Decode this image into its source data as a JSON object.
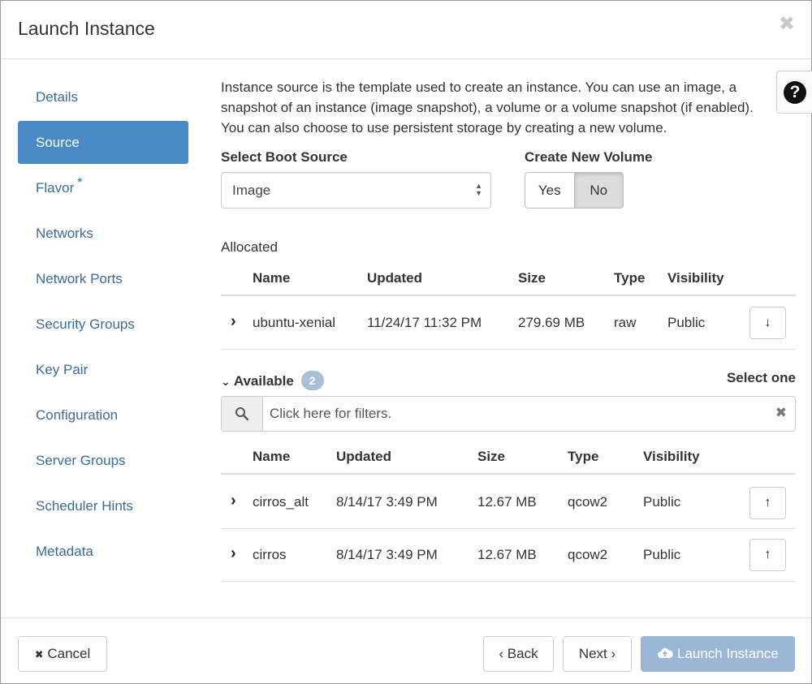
{
  "dialog": {
    "title": "Launch Instance",
    "close_glyph": "✖"
  },
  "sidebar": {
    "items": [
      {
        "label": "Details",
        "active": false
      },
      {
        "label": "Source",
        "active": true
      },
      {
        "label": "Flavor",
        "active": false,
        "required": "*"
      },
      {
        "label": "Networks",
        "active": false
      },
      {
        "label": "Network Ports",
        "active": false
      },
      {
        "label": "Security Groups",
        "active": false
      },
      {
        "label": "Key Pair",
        "active": false
      },
      {
        "label": "Configuration",
        "active": false
      },
      {
        "label": "Server Groups",
        "active": false
      },
      {
        "label": "Scheduler Hints",
        "active": false
      },
      {
        "label": "Metadata",
        "active": false
      }
    ]
  },
  "help": {
    "glyph": "?"
  },
  "main": {
    "description": "Instance source is the template used to create an instance. You can use an image, a snapshot of an instance (image snapshot), a volume or a volume snapshot (if enabled). You can also choose to use persistent storage by creating a new volume.",
    "boot_source": {
      "label": "Select Boot Source",
      "value": "Image"
    },
    "new_volume": {
      "label": "Create New Volume",
      "yes": "Yes",
      "no": "No",
      "selected": "No"
    },
    "allocated": {
      "label": "Allocated",
      "columns": [
        "Name",
        "Updated",
        "Size",
        "Type",
        "Visibility"
      ],
      "rows": [
        {
          "name": "ubuntu-xenial",
          "updated": "11/24/17 11:32 PM",
          "size": "279.69 MB",
          "type": "raw",
          "visibility": "Public"
        }
      ]
    },
    "available": {
      "label": "Available",
      "count": "2",
      "select_hint": "Select one",
      "filter_placeholder": "Click here for filters.",
      "columns": [
        "Name",
        "Updated",
        "Size",
        "Type",
        "Visibility"
      ],
      "rows": [
        {
          "name": "cirros_alt",
          "updated": "8/14/17 3:49 PM",
          "size": "12.67 MB",
          "type": "qcow2",
          "visibility": "Public"
        },
        {
          "name": "cirros",
          "updated": "8/14/17 3:49 PM",
          "size": "12.67 MB",
          "type": "qcow2",
          "visibility": "Public"
        }
      ]
    }
  },
  "footer": {
    "cancel": "Cancel",
    "back": "Back",
    "next": "Next",
    "launch": "Launch Instance"
  },
  "colors": {
    "accent": "#4a8ac6",
    "link": "#3b6a96",
    "primary_disabled": "#9ab8d6"
  }
}
